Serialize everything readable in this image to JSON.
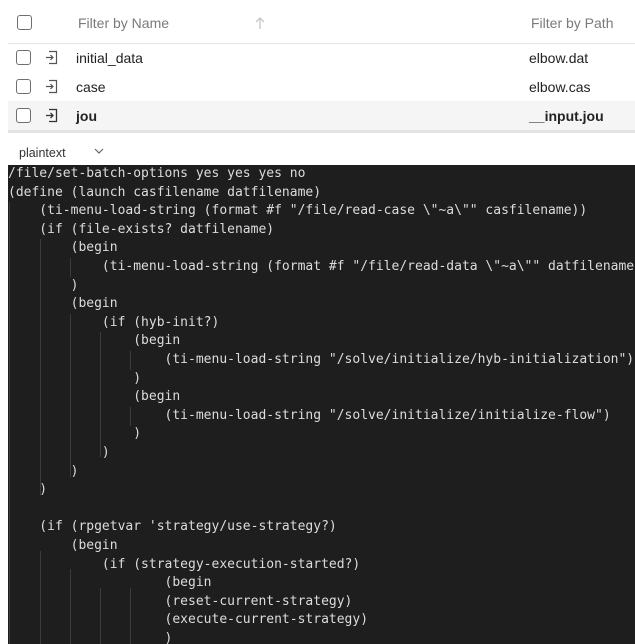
{
  "table": {
    "columns": {
      "name": "Filter by Name",
      "path": "Filter by Path"
    },
    "rows": [
      {
        "name": "initial_data",
        "path": "elbow.dat",
        "selected": false
      },
      {
        "name": "case",
        "path": "elbow.cas",
        "selected": false
      },
      {
        "name": "jou",
        "path": "__input.jou",
        "selected": true
      }
    ],
    "icons": {
      "sort": "arrow-up-icon",
      "file": "file-input-icon",
      "checkbox": "checkbox-icon"
    }
  },
  "language": {
    "selected": "plaintext",
    "icon": "chevron-down-icon"
  },
  "code": {
    "lines": [
      "/file/set-batch-options yes yes yes no",
      "(define (launch casfilename datfilename)",
      "    (ti-menu-load-string (format #f \"/file/read-case \\\"~a\\\"\" casfilename))",
      "    (if (file-exists? datfilename)",
      "        (begin",
      "            (ti-menu-load-string (format #f \"/file/read-data \\\"~a\\\"\" datfilename))",
      "        )",
      "        (begin",
      "            (if (hyb-init?)",
      "                (begin",
      "                    (ti-menu-load-string \"/solve/initialize/hyb-initialization\")",
      "                )",
      "                (begin",
      "                    (ti-menu-load-string \"/solve/initialize/initialize-flow\")",
      "                )",
      "            )",
      "        )",
      "    )",
      "",
      "    (if (rpgetvar 'strategy/use-strategy?)",
      "        (begin",
      "            (if (strategy-execution-started?)",
      "                    (begin",
      "                    (reset-current-strategy)",
      "                    (execute-current-strategy)",
      "                    )"
    ]
  },
  "colors": {
    "editor_background": "#1e1e1e",
    "editor_text": "#dcdcdc",
    "selected_row": "#f5f5f5",
    "header_text": "#7a7a7a"
  }
}
